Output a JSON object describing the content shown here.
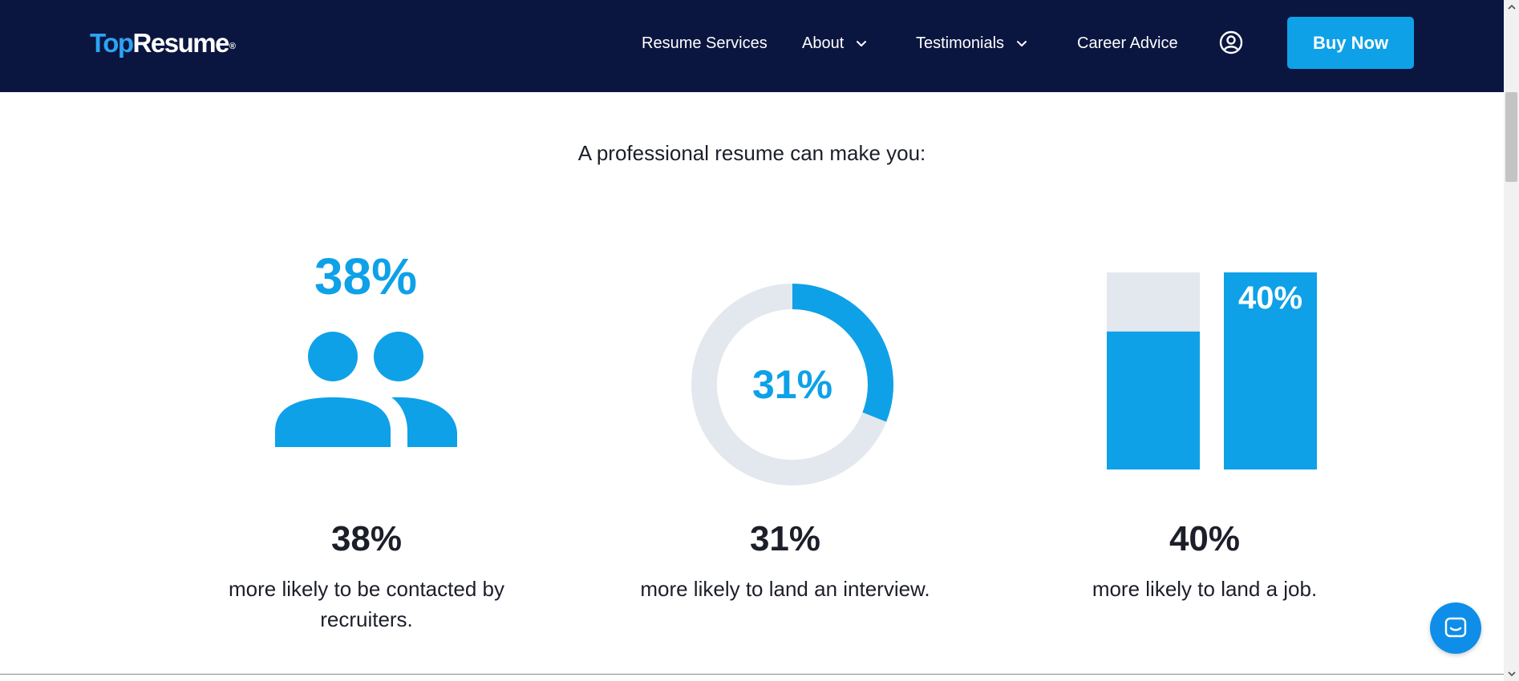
{
  "header": {
    "logo": {
      "part1": "Top",
      "part2": "Resume",
      "reg": "®"
    },
    "nav": [
      {
        "label": "Resume Services",
        "has_dropdown": false
      },
      {
        "label": "About",
        "has_dropdown": true
      },
      {
        "label": "Testimonials",
        "has_dropdown": true
      },
      {
        "label": "Career Advice",
        "has_dropdown": false
      }
    ],
    "user_icon": "user-circle-icon",
    "buy_label": "Buy Now"
  },
  "main": {
    "headline": "A professional resume can make you:",
    "stats": [
      {
        "icon_value": "38%",
        "value": "38%",
        "description": "more likely to be contacted by recruiters.",
        "visual": "people-icon"
      },
      {
        "icon_value": "31%",
        "value": "31%",
        "description": "more likely to land an interview.",
        "visual": "donut"
      },
      {
        "icon_value": "40%",
        "value": "40%",
        "description": "more likely to land a job.",
        "visual": "bars"
      }
    ]
  },
  "chart_data": [
    {
      "type": "pie",
      "title": "",
      "values": [
        31,
        69
      ],
      "labels": [
        "31%",
        ""
      ],
      "colors": [
        "#0ea1e8",
        "#e3e8ef"
      ]
    },
    {
      "type": "bar",
      "title": "",
      "categories": [
        "",
        ""
      ],
      "values": [
        70,
        100
      ],
      "labels": [
        "",
        "40%"
      ],
      "colors": [
        "#0ea1e8",
        "#0ea1e8"
      ],
      "ylim": [
        0,
        100
      ]
    }
  ],
  "colors": {
    "header_bg": "#0b1640",
    "accent": "#0ea1e8",
    "track": "#e3e8ef",
    "text": "#1c1f2a"
  },
  "chat_icon": "chat-bubble-icon"
}
